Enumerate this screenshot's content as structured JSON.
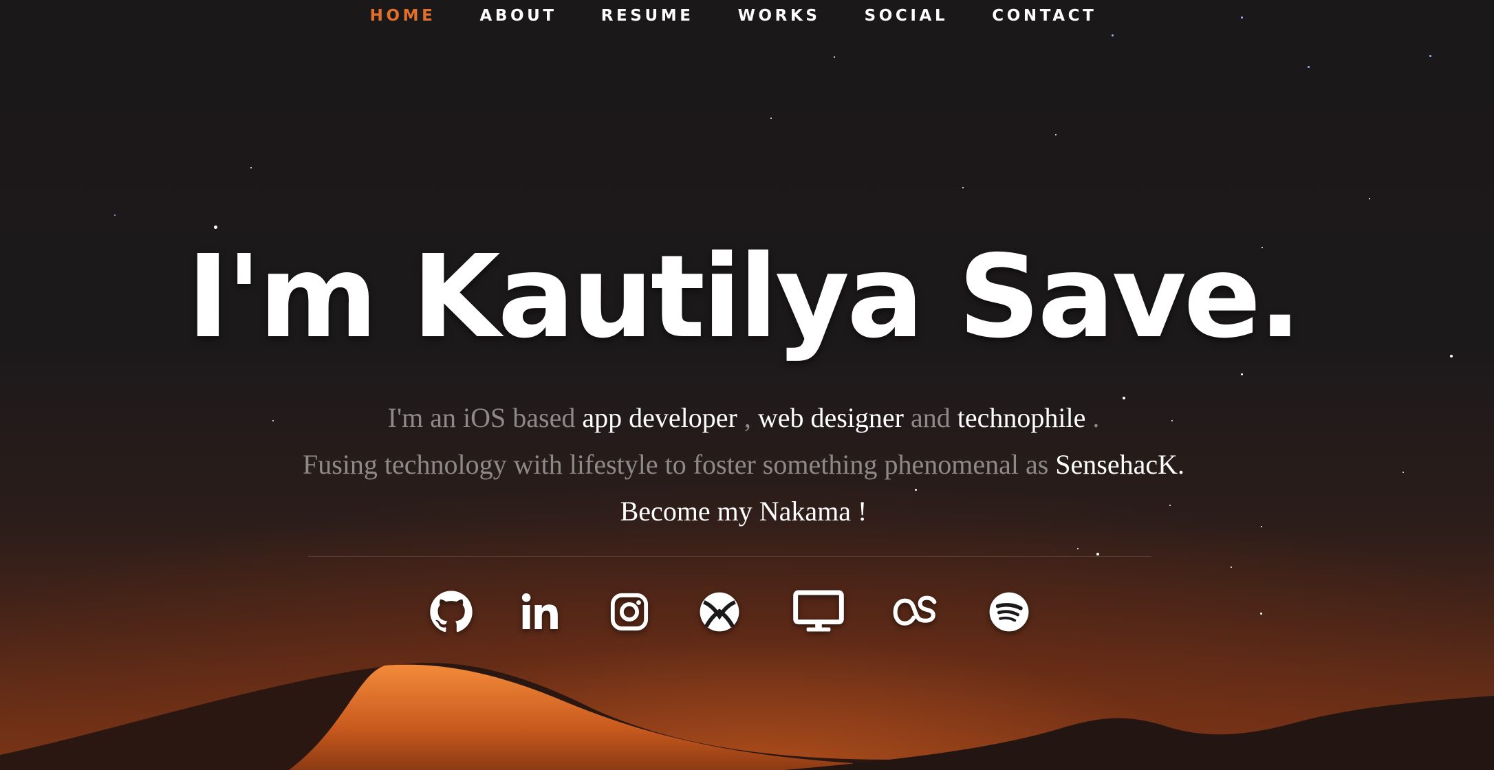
{
  "nav": {
    "items": [
      {
        "label": "HOME",
        "active": true
      },
      {
        "label": "ABOUT",
        "active": false
      },
      {
        "label": "RESUME",
        "active": false
      },
      {
        "label": "WORKS",
        "active": false
      },
      {
        "label": "SOCIAL",
        "active": false
      },
      {
        "label": "CONTACT",
        "active": false
      }
    ]
  },
  "hero": {
    "title": "I'm Kautilya Save.",
    "line1": {
      "prefix": "I'm an iOS based ",
      "role1": "app developer",
      "sep1": " , ",
      "role2": "web designer",
      "sep2": " and ",
      "role3": "technophile",
      "suffix": " ."
    },
    "line2": {
      "prefix": "Fusing technology with lifestyle to foster something phenomenal as ",
      "brand": "SensehacK."
    },
    "line3": "Become my Nakama !"
  },
  "social": {
    "icons": [
      "github-icon",
      "linkedin-icon",
      "instagram-icon",
      "xbox-icon",
      "desktop-icon",
      "lastfm-icon",
      "spotify-icon"
    ]
  },
  "colors": {
    "accent": "#e0702c",
    "background": "#1c191b",
    "text": "#ffffff",
    "muted_text": "#8f8a8a"
  }
}
